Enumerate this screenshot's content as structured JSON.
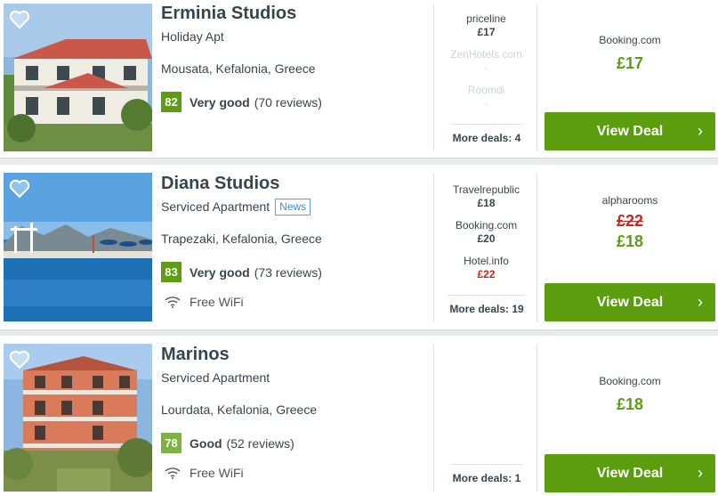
{
  "results": [
    {
      "name": "Erminia Studios",
      "type": "Holiday Apt",
      "badge": "",
      "location": "Mousata, Kefalonia, Greece",
      "score": "82",
      "rating_label": "Very good",
      "reviews": "(70 reviews)",
      "wifi": "",
      "other_prices": [
        {
          "provider": "priceline",
          "price": "£17"
        },
        {
          "provider": "ZenHotels.com",
          "price": "-"
        },
        {
          "provider": "Roomdi",
          "price": "-"
        }
      ],
      "more_deals": "More deals: 4",
      "deal_provider": "Booking.com",
      "deal_old_price": "",
      "deal_price": "£17",
      "button": "View Deal"
    },
    {
      "name": "Diana Studios",
      "type": "Serviced Apartment",
      "badge": "News",
      "location": "Trapezaki, Kefalonia, Greece",
      "score": "83",
      "rating_label": "Very good",
      "reviews": "(73 reviews)",
      "wifi": "Free WiFi",
      "other_prices": [
        {
          "provider": "Travelrepublic",
          "price": "£18"
        },
        {
          "provider": "Booking.com",
          "price": "£20"
        },
        {
          "provider": "Hotel.info",
          "price": "£22"
        }
      ],
      "more_deals": "More deals: 19",
      "deal_provider": "alpharooms",
      "deal_old_price": "£22",
      "deal_price": "£18",
      "button": "View Deal"
    },
    {
      "name": "Marinos",
      "type": "Serviced Apartment",
      "badge": "",
      "location": "Lourdata, Kefalonia, Greece",
      "score": "78",
      "rating_label": "Good",
      "reviews": "(52 reviews)",
      "wifi": "Free WiFi",
      "other_prices": [],
      "more_deals": "More deals: 1",
      "deal_provider": "Booking.com",
      "deal_old_price": "",
      "deal_price": "£18",
      "button": "View Deal"
    }
  ],
  "icons": {
    "favorite": "heart-icon",
    "wifi": "wifi-icon",
    "chevron": "chevron-right-icon"
  },
  "colors": {
    "deal_button": "#5c9d0f",
    "price_green": "#5d9c13",
    "price_red": "#c5281c",
    "score_green": "#5d9c13",
    "score_light_green": "#7cb342"
  }
}
